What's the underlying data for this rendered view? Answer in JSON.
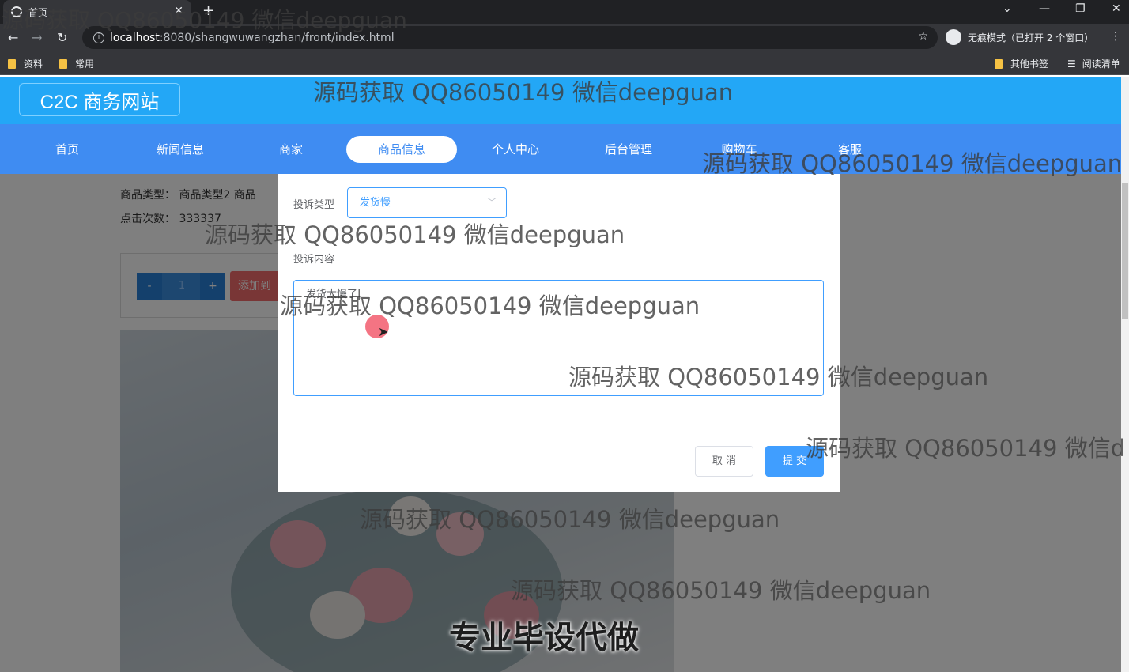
{
  "browser": {
    "tab_title": "首页",
    "url_host": "localhost",
    "url_rest": ":8080/shangwuwangzhan/front/index.html",
    "incognito_label": "无痕模式（已打开 2 个窗口）",
    "bookmarks_left": [
      "资料",
      "常用"
    ],
    "bookmarks_right": [
      "其他书签",
      "阅读清单"
    ]
  },
  "site": {
    "logo": "C2C 商务网站",
    "nav": [
      "首页",
      "新闻信息",
      "商家",
      "商品信息",
      "个人中心",
      "后台管理",
      "购物车",
      "客服"
    ],
    "active_nav": "商品信息"
  },
  "product": {
    "type_line": "商品类型：   商品类型2    商品",
    "clicks_line": "点击次数：   333337",
    "qty_minus": "-",
    "qty_value": "1",
    "qty_plus": "+",
    "add_to_cart": "添加到"
  },
  "dialog": {
    "type_label": "投诉类型",
    "type_value": "发货慢",
    "content_label": "投诉内容",
    "content_value": "发货太慢了",
    "cancel": "取 消",
    "submit": "提 交"
  },
  "overlay": {
    "watermark": "源码获取 QQ86050149 微信deepguan",
    "watermark_cut": "源码获取 QQ86050149 微信d",
    "caption": "专业毕设代做"
  }
}
